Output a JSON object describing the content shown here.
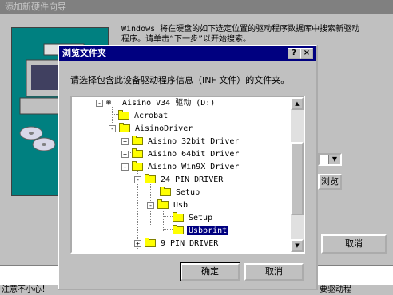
{
  "wizard": {
    "title": "添加新硬件向导",
    "instructions": "Windows 将在硬盘的如下选定位置的驱动程序数据库中搜索新驱动程序。请单击“下一步”以开始搜索。",
    "browse_label": "浏览(R)...",
    "cancel_label": "取消",
    "status_left": "注意不小心！",
    "status_right": "要驱动程"
  },
  "dialog": {
    "title": "浏览文件夹",
    "help_label": "?",
    "close_label": "×",
    "prompt": "请选择包含此设备驱动程序信息（INF 文件）的文件夹。",
    "ok_label": "确定",
    "cancel_label": "取消",
    "tree": [
      {
        "label": "Aisino V34 驱动 (D:)",
        "type": "drive",
        "expander": "-"
      },
      {
        "label": "Acrobat",
        "type": "folder",
        "expander": ""
      },
      {
        "label": "AisinoDriver",
        "type": "folder",
        "expander": "-"
      },
      {
        "label": "Aisino 32bit Driver",
        "type": "folder",
        "expander": "+"
      },
      {
        "label": "Aisino 64bit Driver",
        "type": "folder",
        "expander": "+"
      },
      {
        "label": "Aisino Win9X Driver",
        "type": "folder",
        "expander": "-"
      },
      {
        "label": "24 PIN DRIVER",
        "type": "folder",
        "expander": "-"
      },
      {
        "label": "Setup",
        "type": "folder",
        "expander": ""
      },
      {
        "label": "Usb",
        "type": "folder",
        "expander": "-"
      },
      {
        "label": "Setup",
        "type": "folder",
        "expander": ""
      },
      {
        "label": "Usbprint",
        "type": "folder",
        "expander": "",
        "selected": true
      },
      {
        "label": "9 PIN DRIVER",
        "type": "folder",
        "expander": "+"
      }
    ]
  },
  "colors": {
    "title_active": "#000080",
    "window_face": "#c0c0c0",
    "selection": "#000080",
    "art_bg": "#008080"
  }
}
